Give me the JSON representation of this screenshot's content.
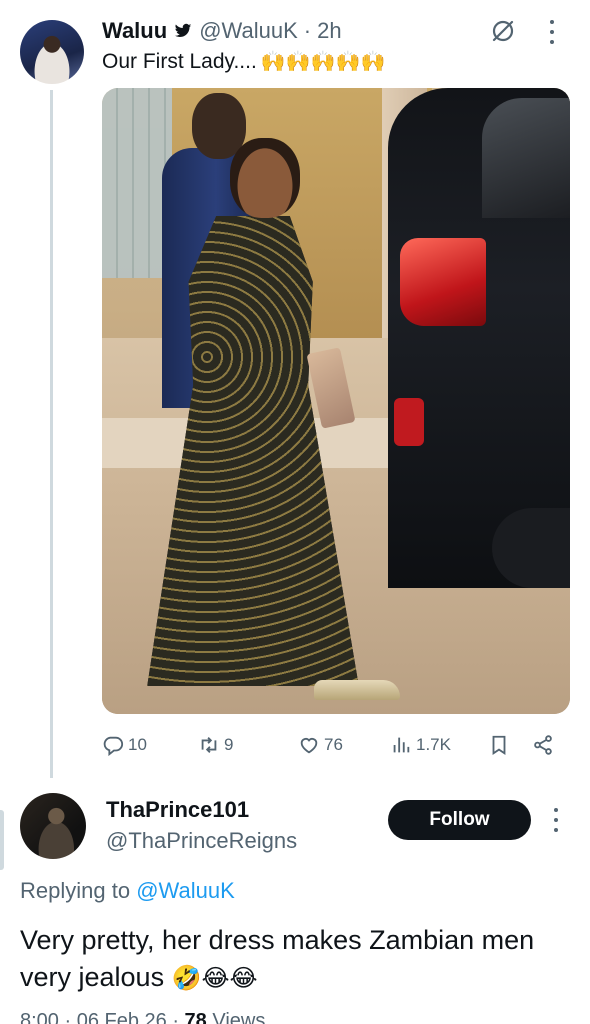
{
  "tweet": {
    "display_name": "Waluu",
    "handle": "@WaluuK",
    "separator": "·",
    "time": "2h",
    "text": "Our First Lady....",
    "emojis": [
      "🙌",
      "🙌",
      "🙌",
      "🙌",
      "🙌"
    ],
    "stats": {
      "replies": "10",
      "retweets": "9",
      "likes": "76",
      "views": "1.7K"
    }
  },
  "reply": {
    "display_name": "ThaPrince101",
    "handle": "@ThaPrinceReigns",
    "follow_label": "Follow",
    "replying_prefix": "Replying to",
    "replying_mention": "@WaluuK",
    "text": "Very pretty, her dress makes Zambian men very jealous",
    "emojis": [
      "🤣",
      "😂",
      "😂"
    ],
    "meta_time": "8:00 · 06 Feb 26 ·",
    "meta_views_count": "78",
    "meta_views_label": "Views"
  },
  "colors": {
    "accent": "#1d9bf0",
    "secondary_text": "#536471",
    "primary_text": "#0f1419",
    "follow_bg": "#0f1419"
  },
  "icons": {
    "verified": "bird-icon",
    "grok": "grok-icon",
    "more": "more-icon",
    "reply": "reply-icon",
    "retweet": "retweet-icon",
    "like": "heart-icon",
    "views": "views-icon",
    "bookmark": "bookmark-icon",
    "share": "share-icon"
  }
}
